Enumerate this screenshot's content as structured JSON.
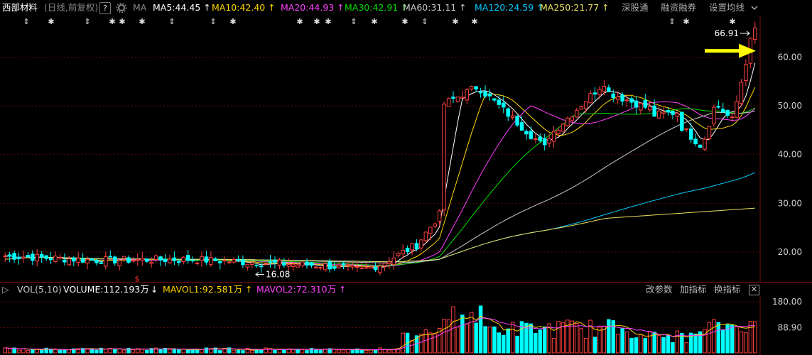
{
  "header": {
    "stock_name": "西部材料",
    "period_mode": "(日线,前复权)",
    "help_label": "?",
    "settings_icon": "gear-icon",
    "ma_label": "MA",
    "ma_items": [
      {
        "label": "MA5:44.45",
        "arrow": "↑",
        "color": "#ffffff"
      },
      {
        "label": "MA10:42.40",
        "arrow": "↑",
        "color": "#ffd700"
      },
      {
        "label": "MA20:44.93",
        "arrow": "↑",
        "color": "#ff40ff"
      },
      {
        "label": "MA30:42.91",
        "arrow": "↑",
        "color": "#00e000"
      },
      {
        "label": "MA60:31.11",
        "arrow": "↑",
        "color": "#cccccc"
      },
      {
        "label": "MA120:24.59",
        "arrow": "↑",
        "color": "#00c8ff"
      },
      {
        "label": "MA250:21.77",
        "arrow": "↑",
        "color": "#e8e060"
      }
    ],
    "link_sz": "深股通",
    "link_margin": "融资融券",
    "link_ma_setting": "设置均线"
  },
  "price_chart": {
    "y_ticks": [
      "60.00",
      "50.00",
      "40.00",
      "30.00",
      "20.00"
    ],
    "high_label": "66.91",
    "low_label": "16.08",
    "event_marker": "$",
    "info_marks": [
      "⇕",
      "✱",
      "⇕",
      "✱✱",
      "✱",
      "⇕",
      "⇕",
      "✱",
      "✱✱✱",
      "⇕",
      "✱",
      "✱",
      "⇕✱",
      "✱",
      "⇕",
      "✱",
      "✱✱✱",
      "✱"
    ],
    "colors": {
      "up": "#ff4040",
      "down": "#00ffff",
      "arrow": "#ffff00"
    }
  },
  "chart_data": {
    "type": "candlestick",
    "ylim": [
      14.0,
      68.0
    ],
    "candles_count": 165,
    "last_close": 66.0,
    "ma_final_values": {
      "MA5": 44.45,
      "MA10": 42.4,
      "MA20": 44.93,
      "MA30": 42.91,
      "MA60": 31.11,
      "MA120": 24.59,
      "MA250": 21.77
    },
    "vol_ylim": [
      0,
      200
    ],
    "vol_ticks": [
      "180.00",
      "88.90"
    ]
  },
  "volume_bar": {
    "toggle": "▷",
    "vol_label": "VOL(5,10)",
    "volume": "VOLUME:112.193万",
    "volume_arrow": "↓",
    "mavol1": "MAVOL1:92.581万",
    "mavol1_arrow": "↑",
    "mavol2": "MAVOL2:72.310万",
    "mavol2_arrow": "↑",
    "btn_params": "改参数",
    "btn_add_indicator": "加指标",
    "btn_switch_indicator": "换指标",
    "close_label": "✕",
    "colors": {
      "volume": "#ffffff",
      "mavol1": "#ffd700",
      "mavol2": "#ff40ff"
    }
  }
}
